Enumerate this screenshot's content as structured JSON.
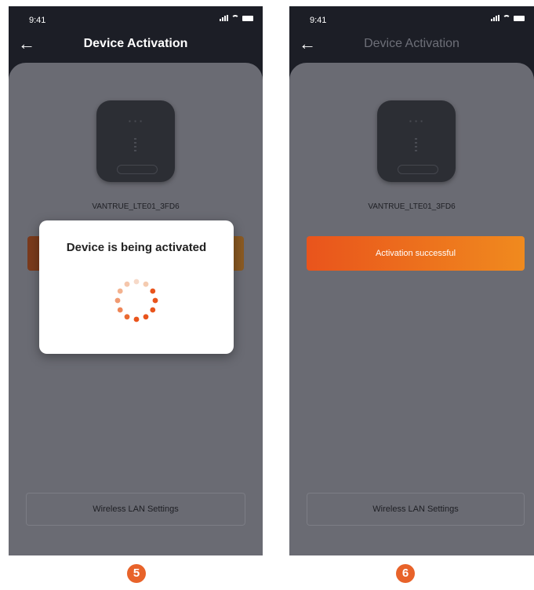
{
  "screens": [
    {
      "status_time": "9:41",
      "title": "Device Activation",
      "device_name": "VANTRUE_LTE01_3FD6",
      "dialog_title": "Device is being activated",
      "wlan_button": "Wireless LAN Settings",
      "step": "5"
    },
    {
      "status_time": "9:41",
      "title": "Device Activation",
      "device_name": "VANTRUE_LTE01_3FD6",
      "status_button": "Activation successful",
      "wlan_button": "Wireless LAN Settings",
      "step": "6"
    }
  ],
  "colors": {
    "accent_start": "#e9541c",
    "accent_end": "#f08a1e",
    "step_badge": "#e8632a"
  },
  "icons": [
    "back-arrow-icon",
    "signal-icon",
    "wifi-icon",
    "battery-icon",
    "loading-spinner-icon"
  ]
}
